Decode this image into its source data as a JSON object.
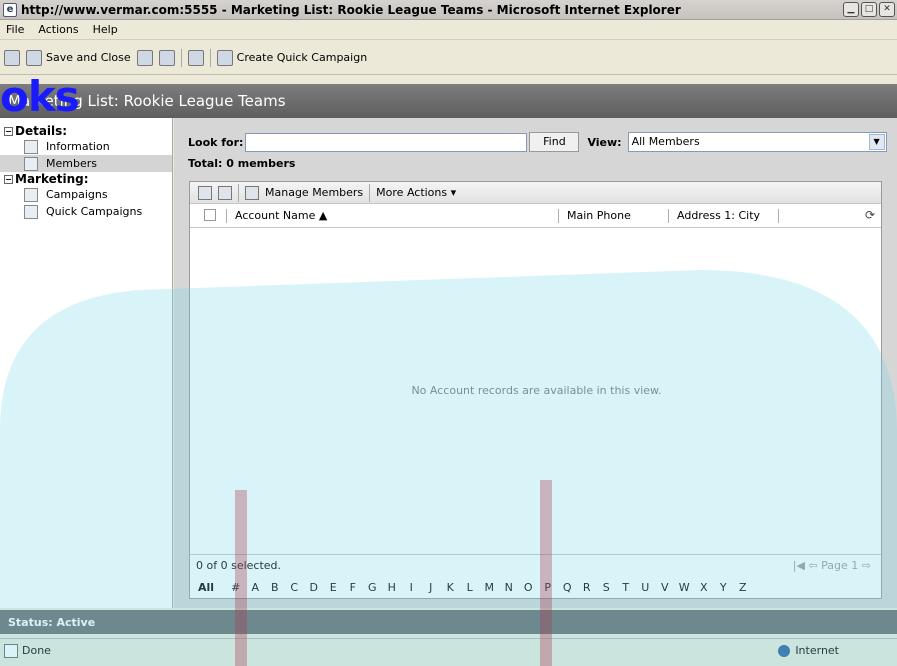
{
  "window": {
    "title": "http://www.vermar.com:5555 - Marketing List: Rookie League Teams - Microsoft Internet Explorer",
    "buttons": [
      "minimize",
      "maximize",
      "close"
    ]
  },
  "menu": [
    "File",
    "Actions",
    "Help"
  ],
  "toolbar": {
    "save_close": "Save and Close",
    "create_campaign": "Create Quick Campaign"
  },
  "header": {
    "title": "Marketing List: Rookie League Teams"
  },
  "watermark": "oks",
  "nav": {
    "details_label": "Details:",
    "information": "Information",
    "members": "Members",
    "marketing_label": "Marketing:",
    "campaigns": "Campaigns",
    "quick_campaigns": "Quick Campaigns"
  },
  "search": {
    "look_for_label": "Look for:",
    "value": "",
    "find_label": "Find",
    "view_label": "View:",
    "view_value": "All Members"
  },
  "total": "Total: 0 members",
  "grid": {
    "manage_members": "Manage Members",
    "more_actions": "More Actions ▾",
    "columns": [
      "Account Name ▲",
      "Main Phone",
      "Address 1: City"
    ],
    "empty_message": "No Account records are available in this view.",
    "selected": "0 of 0 selected.",
    "page": "Page 1",
    "alpha_all": "All",
    "alpha": [
      "#",
      "A",
      "B",
      "C",
      "D",
      "E",
      "F",
      "G",
      "H",
      "I",
      "J",
      "K",
      "L",
      "M",
      "N",
      "O",
      "P",
      "Q",
      "R",
      "S",
      "T",
      "U",
      "V",
      "W",
      "X",
      "Y",
      "Z"
    ]
  },
  "status": "Status: Active",
  "ie_status": {
    "text": "Done",
    "zone": "Internet"
  }
}
